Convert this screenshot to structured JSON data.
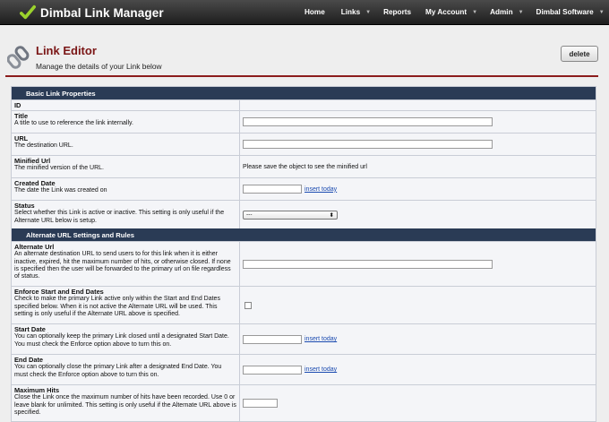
{
  "app": {
    "name": "Dimbal Link Manager"
  },
  "nav": [
    {
      "label": "Home",
      "caret": false
    },
    {
      "label": "Links",
      "caret": true
    },
    {
      "label": "Reports",
      "caret": false
    },
    {
      "label": "My Account",
      "caret": true
    },
    {
      "label": "Admin",
      "caret": true
    },
    {
      "label": "Dimbal Software",
      "caret": true
    }
  ],
  "header": {
    "title": "Link Editor",
    "subtitle": "Manage the details of your Link below",
    "delete_label": "delete"
  },
  "sections": {
    "basic": "Basic Link Properties",
    "alternate": "Alternate URL Settings and Rules"
  },
  "fields": {
    "id": {
      "label": "ID"
    },
    "title": {
      "label": "Title",
      "desc": "A title to use to reference the link internally.",
      "value": ""
    },
    "url": {
      "label": "URL",
      "desc": "The destination URL.",
      "value": ""
    },
    "minified": {
      "label": "Minified Url",
      "desc": "The minified version of the URL.",
      "value": "Please save the object to see the minified url"
    },
    "created": {
      "label": "Created Date",
      "desc": "The date the Link was created on",
      "link": "insert today"
    },
    "status": {
      "label": "Status",
      "desc": "Select whether this Link is active or inactive. This setting is only useful if the Alternate URL below is setup.",
      "selected": "---"
    },
    "alt_url": {
      "label": "Alternate Url",
      "desc": "An alternate destination URL to send users to for this link when it is either inactive, expired, hit the maximum number of hits, or otherwise closed. If none is specified then the user will be forwarded to the primary url on file regardless of status."
    },
    "enforce": {
      "label": "Enforce Start and End Dates",
      "desc": "Check to make the primary Link active only within the Start and End Dates specified below. When it is not active the Alternate URL will be used. This setting is only useful if the Alternate URL above is specified."
    },
    "start": {
      "label": "Start Date",
      "desc": "You can optionally keep the primary Link closed until a designated Start Date. You must check the Enforce option above to turn this on.",
      "link": "insert today"
    },
    "end": {
      "label": "End Date",
      "desc": "You can optionally close the primary Link after a designated End Date. You must check the Enforce option above to turn this on.",
      "link": "insert today"
    },
    "max_hits": {
      "label": "Maximum Hits",
      "desc": "Close the Link once the maximum number of hits have been recorded. Use 0 or leave blank for unlimited. This setting is only useful if the Alternate URL above is specified."
    }
  }
}
